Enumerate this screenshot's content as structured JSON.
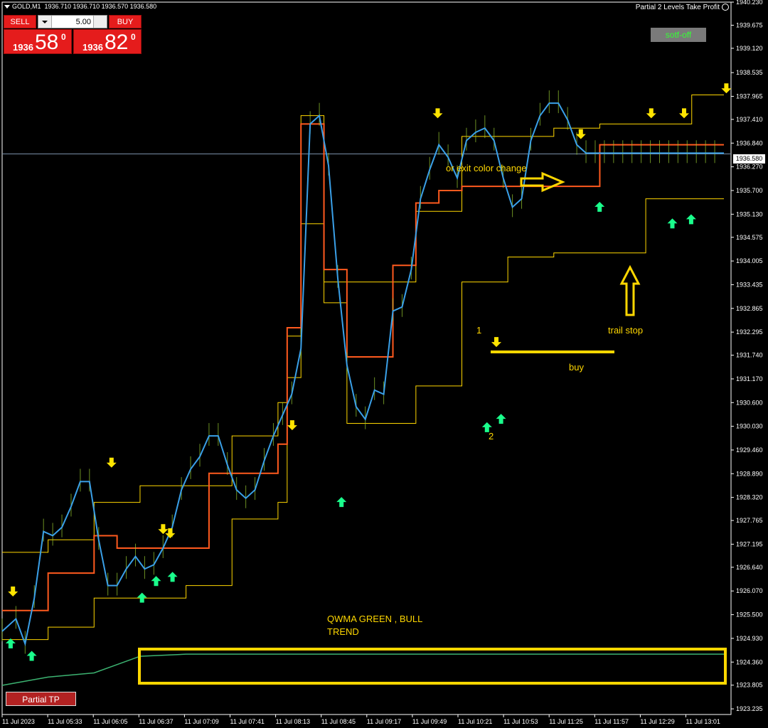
{
  "header": {
    "symbol_info": "GOLD,M1  1936.710 1936.710 1936.570 1936.580",
    "ea_title": "Partial 2 Levels Take Profit"
  },
  "trade_panel": {
    "sell_label": "SELL",
    "buy_label": "BUY",
    "lot_value": "5.00",
    "sell_price_prefix": "1936",
    "sell_price_big": "58",
    "sell_price_sup": "0",
    "buy_price_prefix": "1936",
    "buy_price_big": "82",
    "buy_price_sup": "0"
  },
  "buttons": {
    "soft_off": "sotf-off",
    "partial_tp": "Partial TP"
  },
  "current_price_tag": "1936.580",
  "annotations": {
    "exit_color_change": "or exit color change",
    "label_1": "1",
    "label_2": "2",
    "buy": "buy",
    "trail_stop": "trail stop",
    "qwma_line1": "QWMA GREEN , BULL",
    "qwma_line2": "TREND"
  },
  "colors": {
    "background": "#000000",
    "price_line": "#3aa0e8",
    "bear_line": "#e03030",
    "trail_line": "#ff5a1e",
    "channel": "#ffd700",
    "qwma": "#3cb371",
    "up_arrow": "#1aff8c",
    "down_arrow": "#ffe400",
    "annotation": "#ffd700"
  },
  "chart_data": {
    "type": "line",
    "symbol": "GOLD",
    "timeframe": "M1",
    "ylim": [
      1923.185,
      1940.23
    ],
    "y_ticks": [
      "1940.230",
      "1939.675",
      "1939.120",
      "1938.535",
      "1937.965",
      "1937.410",
      "1936.840",
      "1936.270",
      "1935.700",
      "1935.130",
      "1934.575",
      "1934.005",
      "1933.435",
      "1932.865",
      "1932.295",
      "1931.740",
      "1931.170",
      "1930.600",
      "1930.030",
      "1929.460",
      "1928.890",
      "1928.320",
      "1927.765",
      "1927.195",
      "1926.640",
      "1926.070",
      "1925.500",
      "1924.930",
      "1924.360",
      "1923.805",
      "1923.235"
    ],
    "x_ticks": [
      "11 Jul 2023",
      "11 Jul 05:33",
      "11 Jul 06:05",
      "11 Jul 06:37",
      "11 Jul 07:09",
      "11 Jul 07:41",
      "11 Jul 08:13",
      "11 Jul 08:45",
      "11 Jul 09:17",
      "11 Jul 09:49",
      "11 Jul 10:21",
      "11 Jul 10:53",
      "11 Jul 11:25",
      "11 Jul 11:57",
      "11 Jul 12:29",
      "11 Jul 13:01"
    ],
    "current_price": 1936.58,
    "series": [
      {
        "key": "price",
        "x": [
          0,
          3,
          5,
          7,
          9,
          11,
          13,
          15,
          17,
          19,
          21,
          23,
          25,
          27,
          29,
          31,
          33,
          35,
          37,
          39,
          41,
          43,
          45,
          47,
          49,
          51,
          53,
          55,
          57,
          59,
          61,
          63,
          65,
          67,
          69,
          71,
          73,
          75,
          77,
          79,
          81,
          83,
          85,
          87,
          89,
          91,
          93,
          95,
          97,
          99,
          101,
          103,
          105,
          107,
          109,
          111,
          113,
          115,
          117,
          119,
          121,
          123,
          125,
          127,
          129,
          131,
          133,
          135,
          137,
          139,
          141,
          143,
          145,
          147,
          149,
          151,
          153,
          155,
          157
        ],
        "y": [
          1925.1,
          1925.4,
          1924.8,
          1925.9,
          1927.5,
          1927.4,
          1927.6,
          1928.1,
          1928.7,
          1928.7,
          1927.3,
          1926.2,
          1926.2,
          1926.6,
          1926.9,
          1926.6,
          1926.7,
          1927.1,
          1927.6,
          1928.5,
          1929.0,
          1929.3,
          1929.8,
          1929.8,
          1929.1,
          1928.5,
          1928.3,
          1928.5,
          1929.2,
          1929.8,
          1930.3,
          1930.8,
          1931.9,
          1937.3,
          1937.5,
          1936.3,
          1933.6,
          1931.5,
          1930.5,
          1930.2,
          1930.9,
          1930.8,
          1932.8,
          1932.9,
          1933.8,
          1935.5,
          1936.2,
          1936.8,
          1936.5,
          1936.0,
          1936.9,
          1937.1,
          1937.2,
          1936.9,
          1936.0,
          1935.3,
          1935.5,
          1936.9,
          1937.5,
          1937.8,
          1937.8,
          1937.4,
          1936.8,
          1936.6,
          1936.6,
          1936.6,
          1936.6,
          1936.6,
          1936.6,
          1936.6,
          1936.6,
          1936.6,
          1936.6,
          1936.6,
          1936.6,
          1936.6,
          1936.6,
          1936.6,
          1936.6
        ]
      },
      {
        "key": "trail",
        "x": [
          0,
          10,
          20,
          25,
          35,
          45,
          50,
          60,
          62,
          65,
          70,
          75,
          80,
          85,
          90,
          95,
          100,
          105,
          110,
          112,
          115,
          120,
          125,
          130,
          135,
          140,
          145,
          150,
          155,
          157
        ],
        "y": [
          1925.6,
          1926.5,
          1927.4,
          1927.1,
          1927.1,
          1928.9,
          1928.9,
          1929.6,
          1932.4,
          1937.3,
          1933.8,
          1931.7,
          1931.7,
          1933.9,
          1935.4,
          1935.7,
          1935.8,
          1935.8,
          1935.8,
          1935.8,
          1935.8,
          1935.8,
          1935.8,
          1936.8,
          1936.8,
          1936.8,
          1936.8,
          1936.8,
          1936.8,
          1936.8
        ]
      },
      {
        "key": "channel_upper",
        "x": [
          0,
          10,
          20,
          30,
          40,
          50,
          55,
          60,
          62,
          65,
          70,
          75,
          80,
          90,
          100,
          110,
          120,
          130,
          140,
          150,
          157
        ],
        "y": [
          1927.0,
          1927.3,
          1928.2,
          1928.6,
          1928.6,
          1929.8,
          1929.8,
          1930.6,
          1932.2,
          1937.5,
          1933.5,
          1933.5,
          1933.5,
          1935.2,
          1937.0,
          1937.0,
          1937.2,
          1937.3,
          1937.3,
          1938.0,
          1938.0
        ]
      },
      {
        "key": "channel_lower",
        "x": [
          0,
          10,
          20,
          30,
          40,
          50,
          55,
          60,
          62,
          65,
          70,
          75,
          80,
          90,
          100,
          110,
          120,
          130,
          140,
          150,
          157
        ],
        "y": [
          1924.9,
          1925.2,
          1925.9,
          1925.9,
          1926.2,
          1927.8,
          1927.8,
          1928.2,
          1931.2,
          1934.9,
          1933.0,
          1930.1,
          1930.1,
          1931.0,
          1933.5,
          1934.1,
          1934.2,
          1934.2,
          1935.5,
          1935.5,
          1935.5
        ]
      },
      {
        "key": "qwma",
        "x": [
          0,
          10,
          20,
          30,
          40,
          50,
          60,
          70,
          80,
          90,
          100,
          110,
          120,
          130,
          140,
          150,
          157
        ],
        "y": [
          1923.8,
          1924.0,
          1924.1,
          1924.5,
          1924.55,
          1924.55,
          1924.55,
          1924.55,
          1924.55,
          1924.55,
          1924.55,
          1924.55,
          1924.55,
          1924.55,
          1924.55,
          1924.55,
          1924.55
        ]
      }
    ]
  }
}
